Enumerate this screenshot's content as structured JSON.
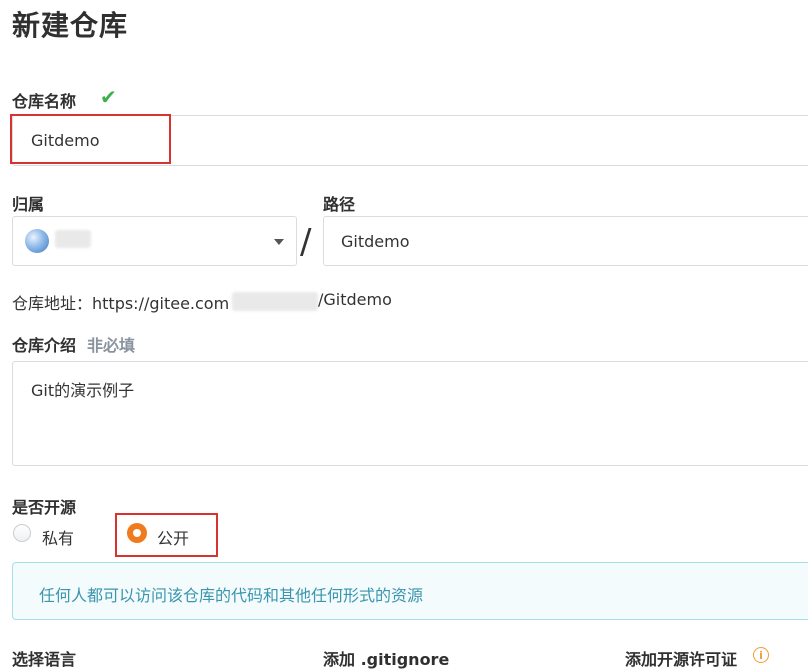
{
  "page": {
    "title": "新建仓库"
  },
  "repo_name": {
    "label": "仓库名称",
    "value": "Gitdemo",
    "valid_icon": "checkmark-icon"
  },
  "owner": {
    "label": "归属",
    "avatar_icon": "globe-avatar-icon"
  },
  "path": {
    "separator": "/",
    "label": "路径",
    "value": "Gitdemo"
  },
  "repo_url": {
    "prefix": "仓库地址：https://gitee.com",
    "suffix": "/Gitdemo"
  },
  "description": {
    "label": "仓库介绍",
    "optional": "非必填",
    "value": "Git的演示例子"
  },
  "visibility": {
    "label": "是否开源",
    "private_label": "私有",
    "public_label": "公开",
    "selected": "公开",
    "notice": "任何人都可以访问该仓库的代码和其他任何形式的资源"
  },
  "bottom": {
    "language_label": "选择语言",
    "gitignore_label": "添加 .gitignore",
    "license_label": "添加开源许可证",
    "license_info_icon": "info-circle-icon"
  },
  "colors": {
    "accent": "#f07a1c",
    "highlight_border": "#d9332f",
    "valid": "#3cb04a",
    "notice_text": "#3a95ad"
  }
}
